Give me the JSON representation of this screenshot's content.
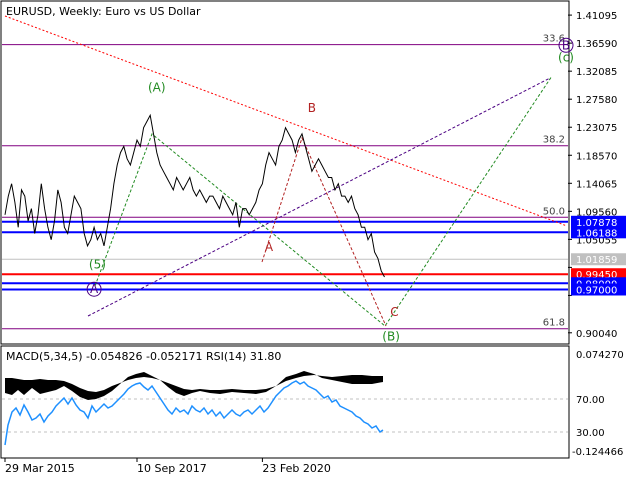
{
  "chart_data": {
    "type": "line",
    "title": "EURUSD, Weekly:  Euro vs US Dollar",
    "price_axis": {
      "ticks": [
        1.41095,
        1.3659,
        1.32085,
        1.2758,
        1.23075,
        1.1857,
        1.14065,
        1.0956,
        1.05055,
        1.0055,
        0.96045,
        0.9004
      ],
      "tick_labels": [
        "1.41095",
        "1.36590",
        "1.32085",
        "1.27580",
        "1.23075",
        "1.18570",
        "1.14065",
        "1.09560",
        "1.05055",
        "",
        "",
        "0.90040"
      ],
      "range": [
        0.884,
        1.432
      ]
    },
    "time_axis": {
      "labels": [
        "29 Mar 2015",
        "10 Sep 2017",
        "23 Feb 2020"
      ],
      "label_bar_index": [
        0,
        40,
        78
      ],
      "bar_count": 116
    },
    "price": [
      1.09,
      1.12,
      1.14,
      1.11,
      1.07,
      1.13,
      1.12,
      1.08,
      1.1,
      1.06,
      1.09,
      1.14,
      1.1,
      1.07,
      1.05,
      1.08,
      1.13,
      1.11,
      1.07,
      1.06,
      1.09,
      1.12,
      1.11,
      1.1,
      1.06,
      1.04,
      1.05,
      1.07,
      1.05,
      1.06,
      1.04,
      1.07,
      1.1,
      1.14,
      1.17,
      1.19,
      1.2,
      1.18,
      1.17,
      1.19,
      1.21,
      1.2,
      1.23,
      1.24,
      1.25,
      1.22,
      1.19,
      1.17,
      1.16,
      1.15,
      1.14,
      1.13,
      1.15,
      1.14,
      1.13,
      1.14,
      1.15,
      1.13,
      1.12,
      1.13,
      1.12,
      1.11,
      1.12,
      1.12,
      1.11,
      1.1,
      1.12,
      1.11,
      1.1,
      1.09,
      1.11,
      1.07,
      1.1,
      1.1,
      1.09,
      1.1,
      1.11,
      1.13,
      1.14,
      1.17,
      1.19,
      1.18,
      1.17,
      1.2,
      1.21,
      1.23,
      1.22,
      1.21,
      1.19,
      1.21,
      1.22,
      1.2,
      1.18,
      1.16,
      1.17,
      1.18,
      1.17,
      1.16,
      1.15,
      1.15,
      1.13,
      1.14,
      1.12,
      1.12,
      1.11,
      1.12,
      1.1,
      1.09,
      1.07,
      1.07,
      1.05,
      1.06,
      1.03,
      1.02,
      1.0,
      0.99
    ],
    "horizontal_levels": [
      {
        "label": "33.6",
        "value": 1.3635,
        "color": "#800080"
      },
      {
        "label": "38.2",
        "value": 1.201,
        "color": "#800080"
      },
      {
        "label": "50.0",
        "value": 1.086,
        "color": "#800080"
      },
      {
        "label": "61.8",
        "value": 0.907,
        "color": "#800080"
      },
      {
        "label": "1.07878",
        "value": 1.07878,
        "color": "#0000ff"
      },
      {
        "label": "1.06188",
        "value": 1.06188,
        "color": "#0000ff"
      },
      {
        "label": "0.99450",
        "value": 0.9945,
        "color": "#ff0000"
      },
      {
        "label": "0.98000",
        "value": 0.98,
        "color": "#0000ff"
      },
      {
        "label": "0.97000",
        "value": 0.97,
        "color": "#0000ff"
      },
      {
        "label": "1.01859",
        "value": 1.01859,
        "color": "#c0c0c0"
      }
    ],
    "wave_labels": [
      {
        "text": "(A)",
        "bar": 46,
        "value": 1.288,
        "color": "#228b22"
      },
      {
        "text": "(5)",
        "bar": 28,
        "value": 1.004,
        "color": "#228b22"
      },
      {
        "text": "(B)",
        "bar": 117,
        "value": 0.888,
        "color": "#228b22"
      },
      {
        "text": "(c)",
        "bar": 170,
        "value": 1.336,
        "color": "#228b22"
      },
      {
        "text": "A",
        "bar": 80,
        "value": 1.032,
        "color": "#b22222"
      },
      {
        "text": "B",
        "bar": 93,
        "value": 1.255,
        "color": "#b22222"
      },
      {
        "text": "C",
        "bar": 118,
        "value": 0.927,
        "color": "#b22222"
      },
      {
        "text": "A",
        "bar": 27,
        "value": 0.964,
        "color": "#4b0082"
      },
      {
        "text": "B",
        "bar": 170,
        "value": 1.356,
        "color": "#4b0082"
      }
    ],
    "macd_panel": {
      "title": "MACD(5,34,5) -0.054826 -0.052171 RSI(14) 31.80",
      "axis_labels": [
        "0.074270",
        "70.00",
        "30.00",
        "-0.124466"
      ]
    }
  }
}
